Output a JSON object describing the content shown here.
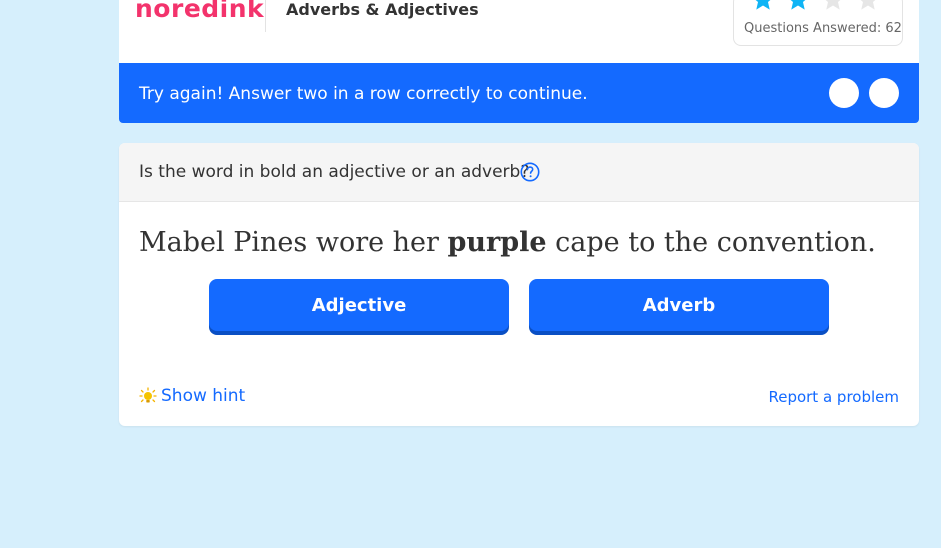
{
  "header": {
    "logo_text_no": "no",
    "logo_text_red": "red",
    "logo_text_ink": "ink",
    "topic": "Adverbs & Adjectives",
    "stars": {
      "filled": 2,
      "total": 4,
      "filled_color": "#0fb4f5",
      "empty_color": "#e6e6e6"
    },
    "questions_answered": "Questions Answered: 62"
  },
  "banner": {
    "message": "Try again! Answer two in a row correctly to continue.",
    "background": "#146aff",
    "progress_dots": 2
  },
  "question": {
    "prompt": "Is the word in bold an adjective or an adverb?",
    "help_icon": "question-circle-icon",
    "sentence_before": "Mabel Pines wore her ",
    "sentence_bold": "purple",
    "sentence_after": " cape to the convention.",
    "choices": [
      "Adjective",
      "Adverb"
    ],
    "hint_label": "Show hint",
    "hint_icon": "lightbulb-icon",
    "report_label": "Report a problem"
  },
  "colors": {
    "page_background": "#d6effc",
    "accent": "#146aff",
    "brand": "#f3336c"
  }
}
